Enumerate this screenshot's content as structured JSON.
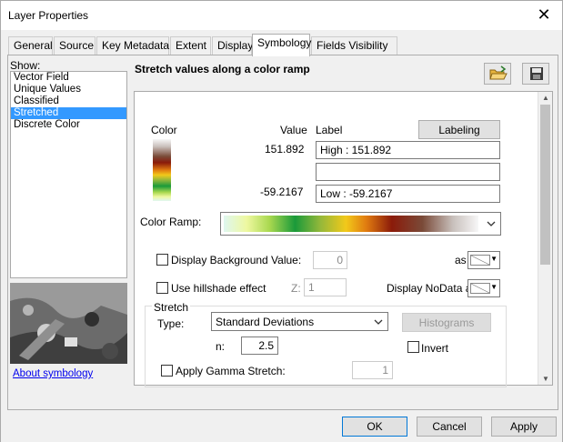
{
  "window": {
    "title": "Layer Properties",
    "close_glyph": "✕"
  },
  "tabs": [
    {
      "label": "General",
      "active": false
    },
    {
      "label": "Source",
      "active": false
    },
    {
      "label": "Key Metadata",
      "active": false
    },
    {
      "label": "Extent",
      "active": false
    },
    {
      "label": "Display",
      "active": false
    },
    {
      "label": "Symbology",
      "active": true
    },
    {
      "label": "Fields Visibility",
      "active": false
    }
  ],
  "show": {
    "label": "Show:",
    "items": [
      "Vector Field",
      "Unique Values",
      "Classified",
      "Stretched",
      "Discrete Color"
    ],
    "selected": "Stretched"
  },
  "about_link": "About symbology",
  "heading": "Stretch values along a color ramp",
  "toolbar": {
    "open_icon": "folder-open-icon",
    "save_icon": "save-icon"
  },
  "legend": {
    "color_header": "Color",
    "value_header": "Value",
    "label_header": "Label",
    "labeling_button": "Labeling",
    "high_value": "151.892",
    "low_value": "-59.2167",
    "high_label": "High : 151.892",
    "mid_label": "",
    "low_label": "Low : -59.2167"
  },
  "color_ramp": {
    "label": "Color Ramp:"
  },
  "background": {
    "label": "Display Background Value:",
    "value": "0",
    "as_label": "as"
  },
  "hillshade": {
    "label": "Use hillshade effect",
    "z_label": "Z:",
    "z_value": "1",
    "nodata_label": "Display NoData as"
  },
  "stretch": {
    "group_label": "Stretch",
    "type_label": "Type:",
    "type_value": "Standard Deviations",
    "histograms_button": "Histograms",
    "n_label": "n:",
    "n_value": "2.5",
    "invert_label": "Invert",
    "gamma_label": "Apply Gamma Stretch:",
    "gamma_value": "1"
  },
  "footer": {
    "ok": "OK",
    "cancel": "Cancel",
    "apply": "Apply"
  }
}
